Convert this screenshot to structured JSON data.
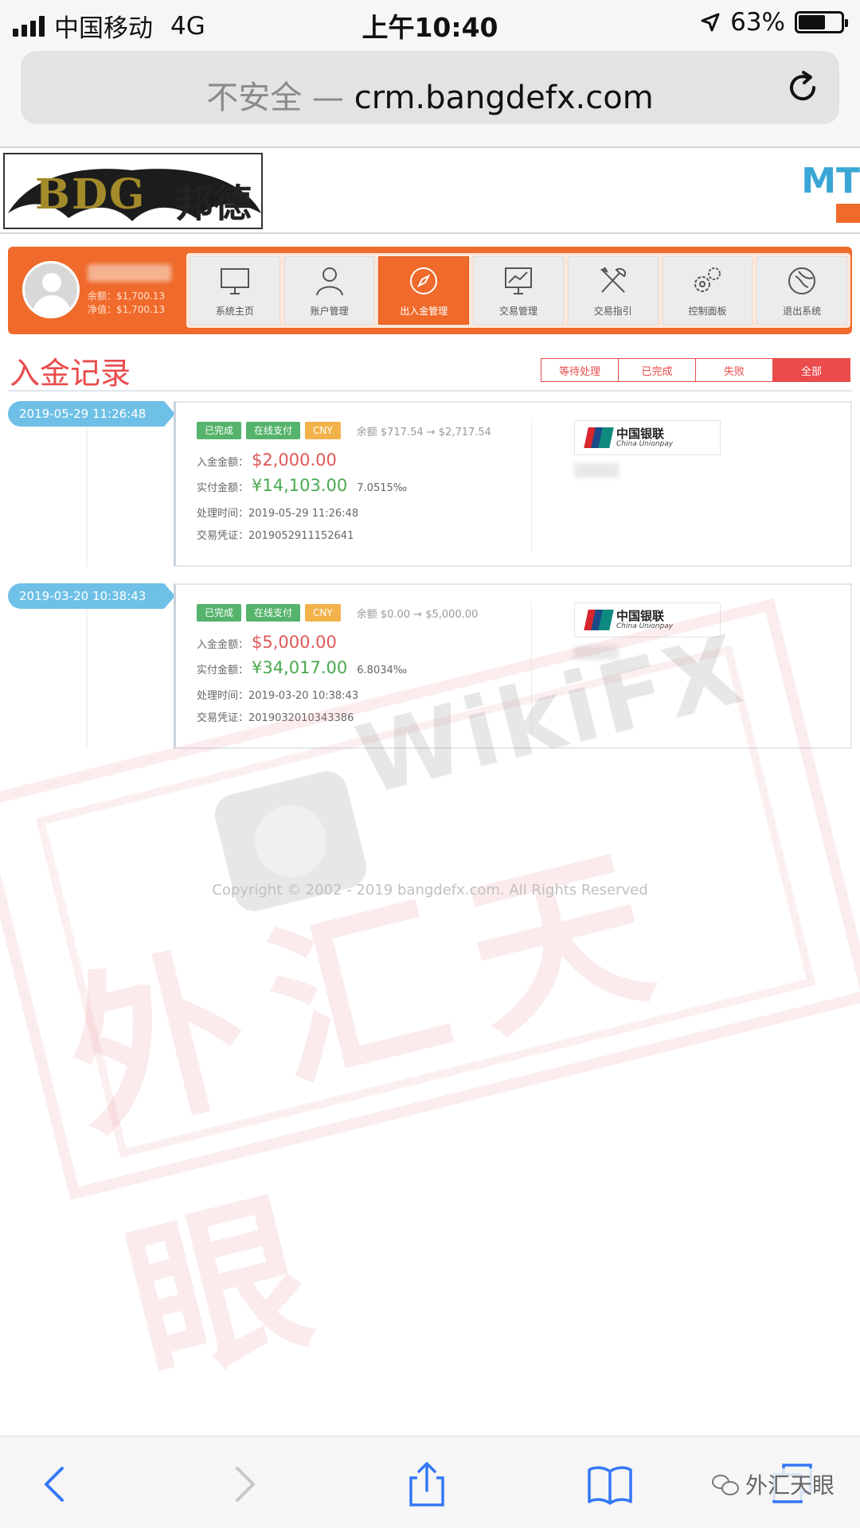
{
  "status_bar": {
    "carrier": "中国移动",
    "network": "4G",
    "time": "上午10:40",
    "battery": "63%",
    "battery_level": 0.63,
    "icons": [
      "signal-icon",
      "location-arrow-icon",
      "battery-icon"
    ]
  },
  "browser": {
    "url_prefix": "不安全 — ",
    "url": "crm.bangdefx.com",
    "reload_icon": "reload-icon"
  },
  "header": {
    "logo_en": "BDG",
    "logo_cn": "邦德",
    "right_text": "MT"
  },
  "nav": {
    "balance": "余额：$1,700.13",
    "equity": "净值：$1,700.13",
    "items": [
      {
        "label": "系统主页",
        "icon": "monitor-icon"
      },
      {
        "label": "账户管理",
        "icon": "user-icon"
      },
      {
        "label": "出入金管理",
        "icon": "compass-icon",
        "active": true
      },
      {
        "label": "交易管理",
        "icon": "chart-board-icon"
      },
      {
        "label": "交易指引",
        "icon": "tools-icon"
      },
      {
        "label": "控制面板",
        "icon": "gears-icon"
      },
      {
        "label": "退出系统",
        "icon": "exit-icon"
      }
    ]
  },
  "page": {
    "title": "入金记录",
    "filters": [
      {
        "label": "等待处理"
      },
      {
        "label": "已完成"
      },
      {
        "label": "失败"
      },
      {
        "label": "全部",
        "active": true
      }
    ]
  },
  "records": [
    {
      "datetime": "2019-05-29   11:26:48",
      "tags": [
        "已完成",
        "在线支付",
        "CNY"
      ],
      "balance_change": "余额 $717.54 → $2,717.54",
      "amount_label": "入金金额：",
      "amount": "$2,000.00",
      "paid_label": "实付金额：",
      "paid": "¥14,103.00",
      "rate": "7.0515‰",
      "time_label": "处理时间：",
      "time": "2019-05-29 11:26:48",
      "voucher_label": "交易凭证：",
      "voucher": "2019052911152641",
      "bank_cn": "中国银联",
      "bank_en": "China Unionpay"
    },
    {
      "datetime": "2019-03-20   10:38:43",
      "tags": [
        "已完成",
        "在线支付",
        "CNY"
      ],
      "balance_change": "余额 $0.00 → $5,000.00",
      "amount_label": "入金金额：",
      "amount": "$5,000.00",
      "paid_label": "实付金额：",
      "paid": "¥34,017.00",
      "rate": "6.8034‰",
      "time_label": "处理时间：",
      "time": "2019-03-20 10:38:43",
      "voucher_label": "交易凭证：",
      "voucher": "2019032010343386",
      "bank_cn": "中国银联",
      "bank_en": "China Unionpay"
    }
  ],
  "footer": {
    "copyright": "Copyright © 2002 - 2019 bangdefx.com. All Rights Reserved"
  },
  "watermark": {
    "brand": "WikiFX",
    "cn": "外汇天眼"
  },
  "toolbar": {
    "icons": [
      "back-icon",
      "forward-icon",
      "share-icon",
      "bookmarks-icon",
      "tabs-icon"
    ],
    "wechat_label": "外汇天眼"
  },
  "colors": {
    "accent": "#ef6a2b",
    "title_red": "#ea4b4b",
    "date_tag_blue": "#6ec0e6",
    "tag_green": "#55b36b",
    "tag_orange": "#f2b24a"
  }
}
